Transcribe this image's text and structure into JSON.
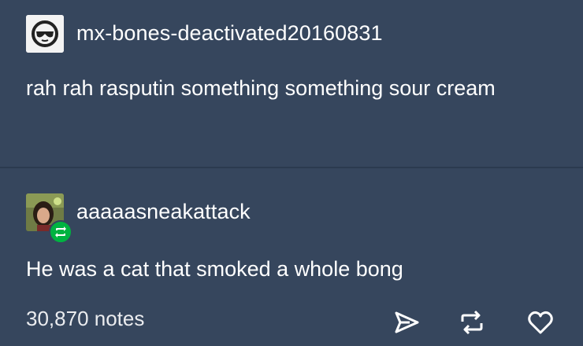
{
  "posts": [
    {
      "username": "mx-bones-deactivated20160831",
      "text": "rah rah rasputin something something sour cream"
    },
    {
      "username": "aaaaasneakattack",
      "text": "He was a cat that smoked a whole bong"
    }
  ],
  "footer": {
    "notes": "30,870 notes"
  },
  "colors": {
    "background": "#36465d",
    "divider": "#2b3a4f",
    "reblog_badge": "#00b341"
  }
}
